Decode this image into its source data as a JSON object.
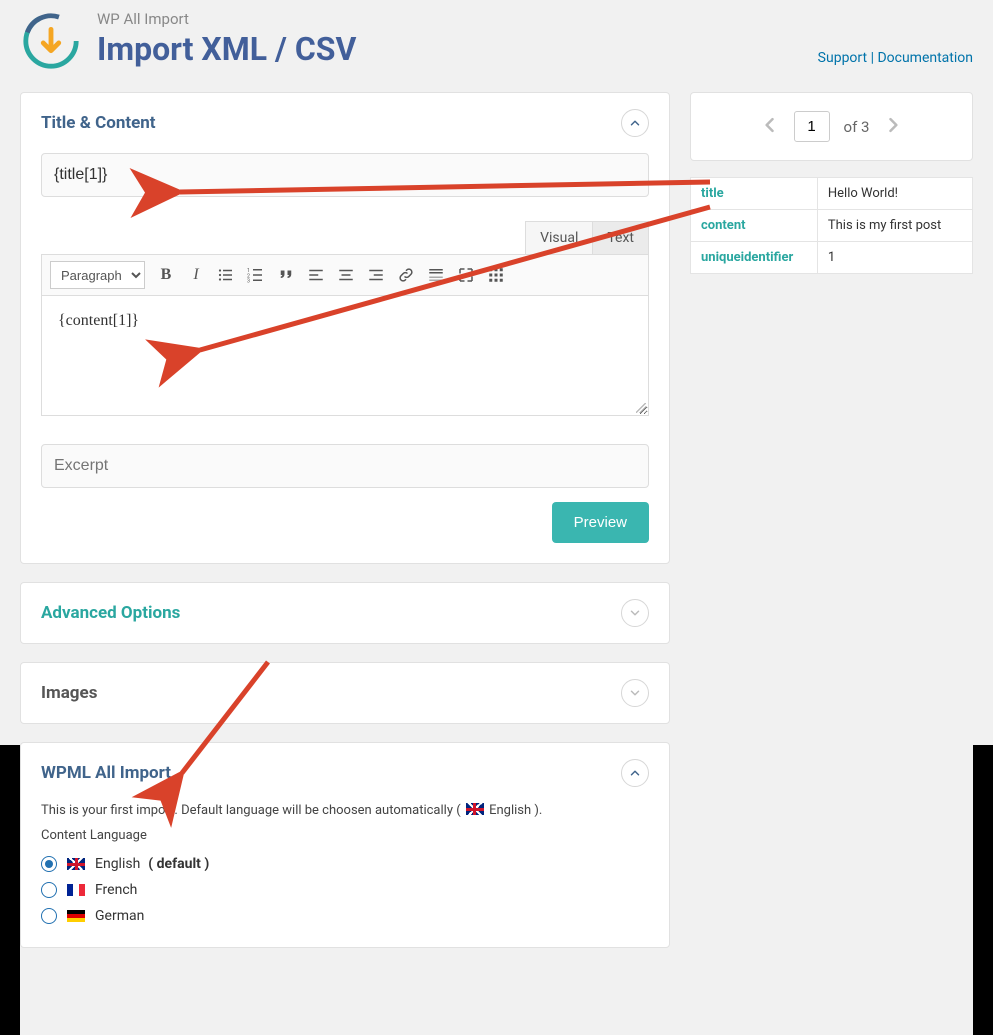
{
  "header": {
    "subtitle": "WP All Import",
    "title": "Import XML / CSV",
    "links": {
      "support": "Support",
      "documentation": "Documentation"
    }
  },
  "panels": {
    "title_content": {
      "title": "Title & Content",
      "title_field_value": "{title[1]}",
      "editor_tabs": {
        "visual": "Visual",
        "text": "Text"
      },
      "format_select": "Paragraph",
      "content_value": "{content[1]}",
      "excerpt_placeholder": "Excerpt",
      "preview_button": "Preview"
    },
    "advanced": {
      "title": "Advanced Options"
    },
    "images": {
      "title": "Images"
    },
    "wpml": {
      "title": "WPML All Import",
      "note_prefix": "This is your first import. Default language will be choosen automatically ( ",
      "note_lang": "English",
      "note_suffix": " ).",
      "content_language_label": "Content Language",
      "languages": [
        {
          "name": "English",
          "default_suffix": " ( default )",
          "flag": "uk",
          "checked": true
        },
        {
          "name": "French",
          "default_suffix": "",
          "flag": "fr",
          "checked": false
        },
        {
          "name": "German",
          "default_suffix": "",
          "flag": "de",
          "checked": false
        }
      ]
    }
  },
  "sidebar": {
    "pager": {
      "page": "1",
      "of": "of 3"
    },
    "record": [
      {
        "key": "title",
        "value": "Hello World!"
      },
      {
        "key": "content",
        "value": "This is my first post"
      },
      {
        "key": "uniqueidentifier",
        "value": "1"
      }
    ]
  }
}
